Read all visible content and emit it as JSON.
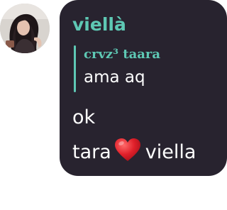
{
  "avatar": {
    "icon": "profile-photo"
  },
  "message": {
    "sender": "viellà",
    "reply": {
      "author": "crvz³ taara",
      "text": "ama aq"
    },
    "line1": "ok",
    "line2_before": "tara",
    "line2_emoji": "red-heart",
    "line2_after": "viella"
  },
  "colors": {
    "bubble": "#28232f",
    "accent": "#5ec8b4",
    "text": "#ffffff",
    "heart": "#e0202a"
  }
}
